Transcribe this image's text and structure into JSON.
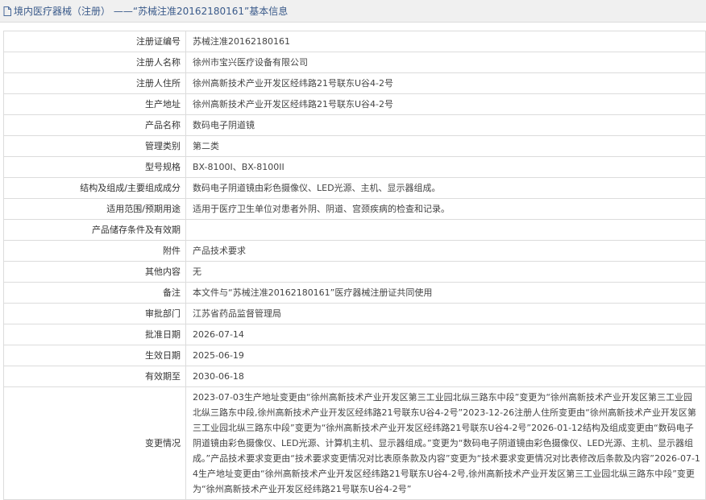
{
  "header": {
    "title": "境内医疗器械（注册） ——“苏械注准20162180161”基本信息"
  },
  "icons": {
    "header_icon": "document-icon"
  },
  "rows": [
    {
      "label": "注册证编号",
      "value": "苏械注准20162180161"
    },
    {
      "label": "注册人名称",
      "value": "徐州市宝兴医疗设备有限公司"
    },
    {
      "label": "注册人住所",
      "value": "徐州高新技术产业开发区经纬路21号联东U谷4-2号"
    },
    {
      "label": "生产地址",
      "value": "徐州高新技术产业开发区经纬路21号联东U谷4-2号"
    },
    {
      "label": "产品名称",
      "value": "数码电子阴道镜"
    },
    {
      "label": "管理类别",
      "value": "第二类"
    },
    {
      "label": "型号规格",
      "value": "BX-8100I、BX-8100II"
    },
    {
      "label": "结构及组成/主要组成成分",
      "value": "数码电子阴道镜由彩色摄像仪、LED光源、主机、显示器组成。"
    },
    {
      "label": "适用范围/预期用途",
      "value": "适用于医疗卫生单位对患者外阴、阴道、宫颈疾病的检查和记录。"
    },
    {
      "label": "产品储存条件及有效期",
      "value": ""
    },
    {
      "label": "附件",
      "value": "产品技术要求"
    },
    {
      "label": "其他内容",
      "value": "无"
    },
    {
      "label": "备注",
      "value": "本文件与“苏械注准20162180161”医疗器械注册证共同使用"
    },
    {
      "label": "审批部门",
      "value": "江苏省药品监督管理局"
    },
    {
      "label": "批准日期",
      "value": "2026-07-14"
    },
    {
      "label": "生效日期",
      "value": "2025-06-19"
    },
    {
      "label": "有效期至",
      "value": "2030-06-18"
    },
    {
      "label": "变更情况",
      "value": "2023-07-03生产地址变更由“徐州高新技术产业开发区第三工业园北纵三路东中段”变更为“徐州高新技术产业开发区第三工业园北纵三路东中段,徐州高新技术产业开发区经纬路21号联东U谷4-2号”2023-12-26注册人住所变更由“徐州高新技术产业开发区第三工业园北纵三路东中段”变更为“徐州高新技术产业开发区经纬路21号联东U谷4-2号”2026-01-12结构及组成变更由“数码电子阴道镜由彩色摄像仪、LED光源、计算机主机、显示器组成。”变更为“数码电子阴道镜由彩色摄像仪、LED光源、主机、显示器组成。”产品技术要求变更由“技术要求变更情况对比表原条款及内容”变更为“技术要求变更情况对比表修改后条款及内容”2026-07-14生产地址变更由“徐州高新技术产业开发区经纬路21号联东U谷4-2号,徐州高新技术产业开发区第三工业园北纵三路东中段”变更为“徐州高新技术产业开发区经纬路21号联东U谷4-2号”"
    }
  ]
}
